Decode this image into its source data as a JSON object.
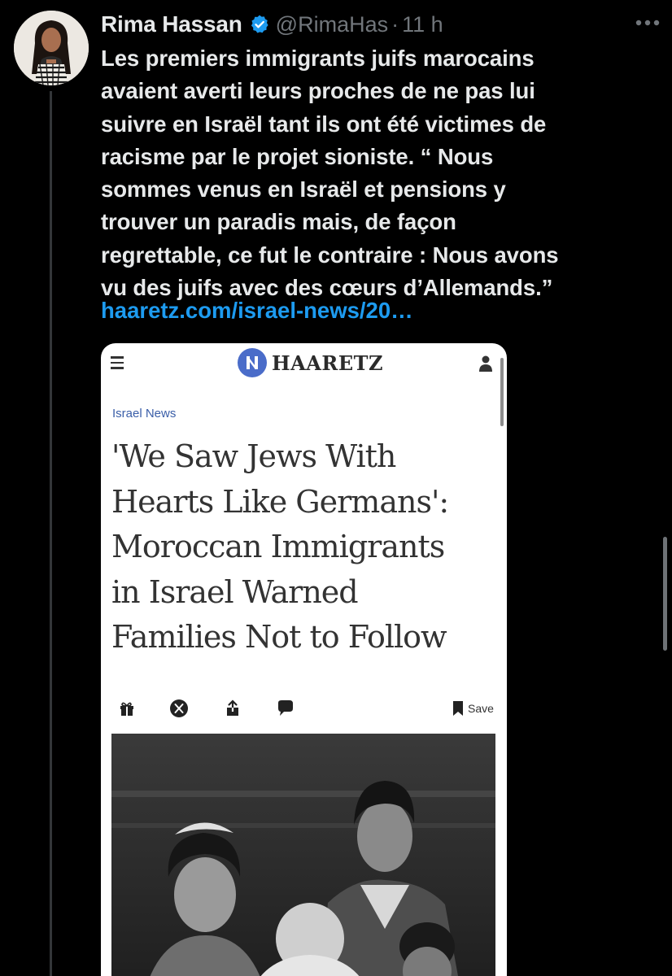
{
  "tweet": {
    "author_name": "Rima Hassan",
    "verified_icon": "verified-badge-icon",
    "handle": "@RimaHas",
    "separator": "·",
    "time": "11 h",
    "text_lines": [
      "Les premiers immigrants juifs marocains",
      "avaient averti leurs proches de ne pas lui",
      "suivre en Israël tant ils ont été victimes de",
      "racisme par le projet sioniste. “ Nous",
      "sommes venus en Israël et pensions y",
      "trouver un paradis mais, de façon",
      "regrettable, ce fut le contraire : Nous avons",
      "vu des juifs avec des cœurs d’Allemands.”"
    ],
    "link": "haaretz.com/israel-news/20…"
  },
  "card": {
    "site_name": "HAARETZ",
    "section": "Israel News",
    "headline_lines": [
      "'We Saw Jews With",
      "Hearts Like Germans':",
      "Moroccan Immigrants",
      "in Israel Warned",
      "Families Not to Follow"
    ],
    "save_label": "Save",
    "share_icons": [
      "gift-icon",
      "x-logo-icon",
      "share-icon",
      "comment-icon",
      "bookmark-icon"
    ]
  },
  "colors": {
    "background": "#000000",
    "text": "#e7e9ea",
    "muted": "#71767b",
    "link": "#1d9bf0",
    "verified": "#1d9bf0",
    "haaretz_blue": "#4a6cc9",
    "section_label": "#3a5ea8"
  }
}
